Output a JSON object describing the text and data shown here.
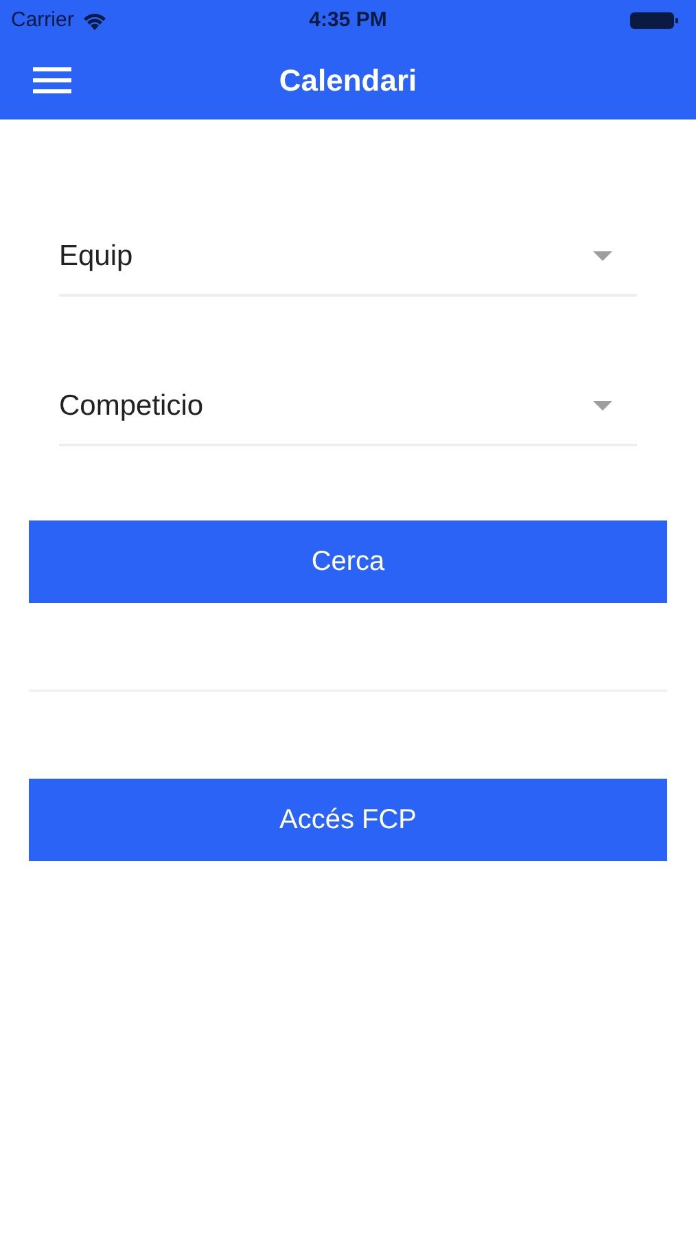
{
  "status_bar": {
    "carrier": "Carrier",
    "time": "4:35 PM"
  },
  "header": {
    "title": "Calendari"
  },
  "selects": [
    {
      "label": "Equip"
    },
    {
      "label": "Competicio"
    }
  ],
  "search_button": "Cerca",
  "access_button": "Accés FCP"
}
